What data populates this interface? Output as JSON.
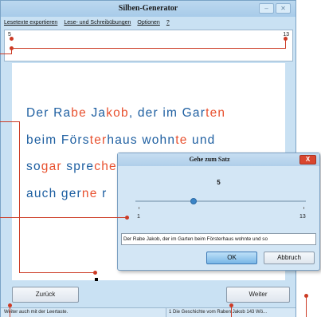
{
  "window": {
    "title": "Silben-Generator",
    "buttons": {
      "minimize": "–",
      "close": "✕"
    }
  },
  "menu": [
    "Lesetexte exportieren",
    "Lese- und Schreibübungen",
    "Optionen",
    "?"
  ],
  "ruler": {
    "min": "5",
    "max": "13"
  },
  "reading_text": {
    "line1": [
      {
        "t": "Der Ra",
        "hl": false
      },
      {
        "t": "be",
        "hl": true
      },
      {
        "t": " Ja",
        "hl": false
      },
      {
        "t": "kob",
        "hl": true
      },
      {
        "t": ", der im Gar",
        "hl": false
      },
      {
        "t": "ten",
        "hl": true
      }
    ],
    "line2": [
      {
        "t": "beim Förs",
        "hl": false
      },
      {
        "t": "ter",
        "hl": true
      },
      {
        "t": "haus wohn",
        "hl": false
      },
      {
        "t": "te",
        "hl": true
      },
      {
        "t": " und",
        "hl": false
      }
    ],
    "line3": [
      {
        "t": "so",
        "hl": false
      },
      {
        "t": "gar",
        "hl": true
      },
      {
        "t": " spre",
        "hl": false
      },
      {
        "t": "che",
        "hl": true
      }
    ],
    "line4": [
      {
        "t": "auch ger",
        "hl": false
      },
      {
        "t": "ne",
        "hl": true
      },
      {
        "t": " r",
        "hl": false
      }
    ],
    "colors": {
      "normal": "#1e5fa1",
      "highlight": "#e8512f"
    }
  },
  "buttons": {
    "back": "Zurück",
    "next": "Weiter"
  },
  "status": {
    "left": "Weiter auch mit der Leertaste.",
    "right": "1 Die Geschichte vom Raben Jakob 143 Wö..."
  },
  "dialog": {
    "title": "Gehe zum Satz",
    "close": "X",
    "value": "5",
    "slider": {
      "min": "1",
      "max": "13",
      "level": 5
    },
    "sentence": "Der Rabe Jakob, der im Garten beim Försterhaus wohnte und so",
    "ok": "OK",
    "cancel": "Abbruch"
  }
}
